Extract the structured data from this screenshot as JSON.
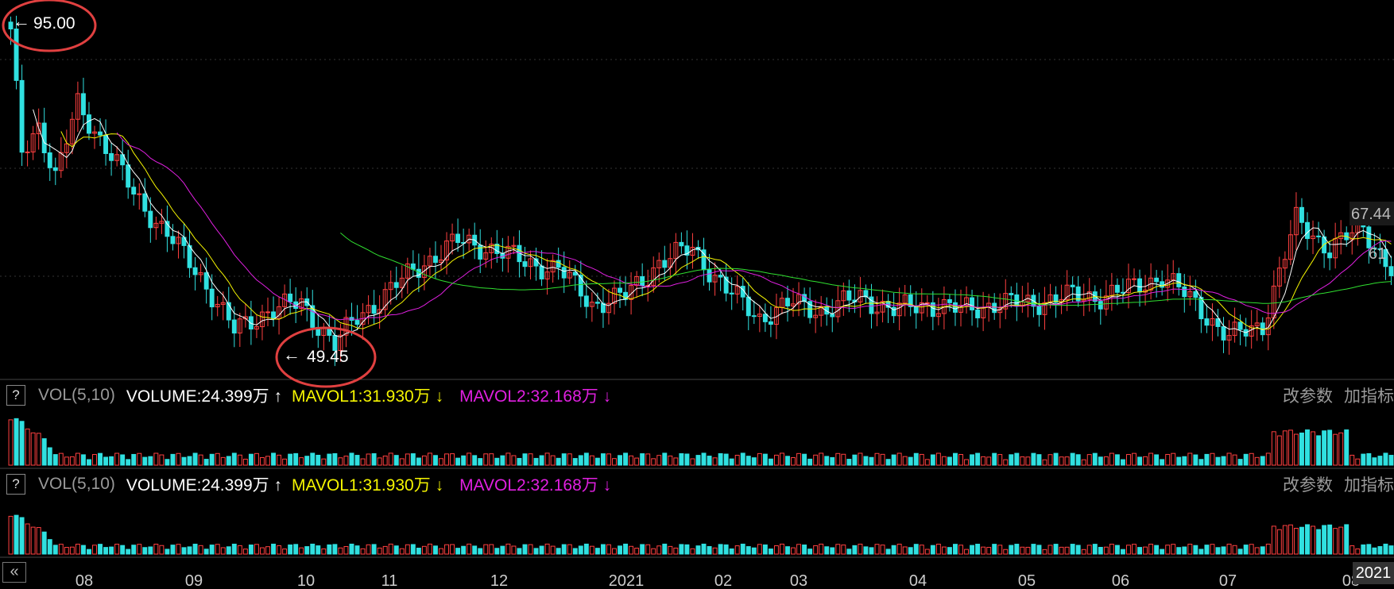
{
  "chart_data": {
    "type": "candlestick",
    "x_ticks": [
      "08",
      "09",
      "10",
      "11",
      "12",
      "2021",
      "02",
      "03",
      "04",
      "05",
      "06",
      "07",
      "08"
    ],
    "annotations": {
      "high": "95.00",
      "low": "49.45",
      "right_labels": [
        "67.44",
        "61"
      ]
    },
    "ylim": [
      45,
      100
    ],
    "price_points": [
      [
        0,
        95
      ],
      [
        2,
        78
      ],
      [
        5,
        82
      ],
      [
        8,
        74
      ],
      [
        12,
        85
      ],
      [
        16,
        80
      ],
      [
        22,
        72
      ],
      [
        28,
        66
      ],
      [
        34,
        60
      ],
      [
        40,
        52
      ],
      [
        46,
        55
      ],
      [
        52,
        56
      ],
      [
        58,
        50
      ],
      [
        62,
        54
      ],
      [
        68,
        58
      ],
      [
        74,
        62
      ],
      [
        80,
        65
      ],
      [
        86,
        64
      ],
      [
        92,
        62
      ],
      [
        98,
        61
      ],
      [
        104,
        56
      ],
      [
        110,
        57
      ],
      [
        116,
        62
      ],
      [
        122,
        64
      ],
      [
        128,
        58
      ],
      [
        134,
        54
      ],
      [
        140,
        56
      ],
      [
        146,
        55
      ],
      [
        152,
        57
      ],
      [
        158,
        55
      ],
      [
        164,
        56
      ],
      [
        170,
        55
      ],
      [
        176,
        56
      ],
      [
        182,
        56
      ],
      [
        188,
        57
      ],
      [
        194,
        57
      ],
      [
        200,
        58
      ],
      [
        206,
        60
      ],
      [
        212,
        56
      ],
      [
        218,
        51
      ],
      [
        224,
        53
      ],
      [
        230,
        68
      ],
      [
        236,
        64
      ],
      [
        242,
        67
      ],
      [
        247,
        61
      ]
    ]
  },
  "indicators": [
    {
      "id": "vol1",
      "help_label": "?",
      "name": "VOL(5,10)",
      "volume": "VOLUME:24.399万",
      "volume_arrow": "↑",
      "mavol1": "MAVOL1:31.930万",
      "mavol1_arrow": "↓",
      "mavol2": "MAVOL2:32.168万",
      "mavol2_arrow": "↓",
      "edit_params": "改参数",
      "add_indicator": "加指标"
    },
    {
      "id": "vol2",
      "help_label": "?",
      "name": "VOL(5,10)",
      "volume": "VOLUME:24.399万",
      "volume_arrow": "↑",
      "mavol1": "MAVOL1:31.930万",
      "mavol1_arrow": "↓",
      "mavol2": "MAVOL2:32.168万",
      "mavol2_arrow": "↓",
      "edit_params": "改参数",
      "add_indicator": "加指标"
    }
  ],
  "nav": {
    "scroll_left": "«",
    "current_period": "2021"
  },
  "colors": {
    "up": "#ff4040",
    "down": "#30e0e0",
    "ma5": "#ffffff",
    "ma10": "#f5f500",
    "ma20": "#e020e0",
    "ma60": "#30e030"
  }
}
